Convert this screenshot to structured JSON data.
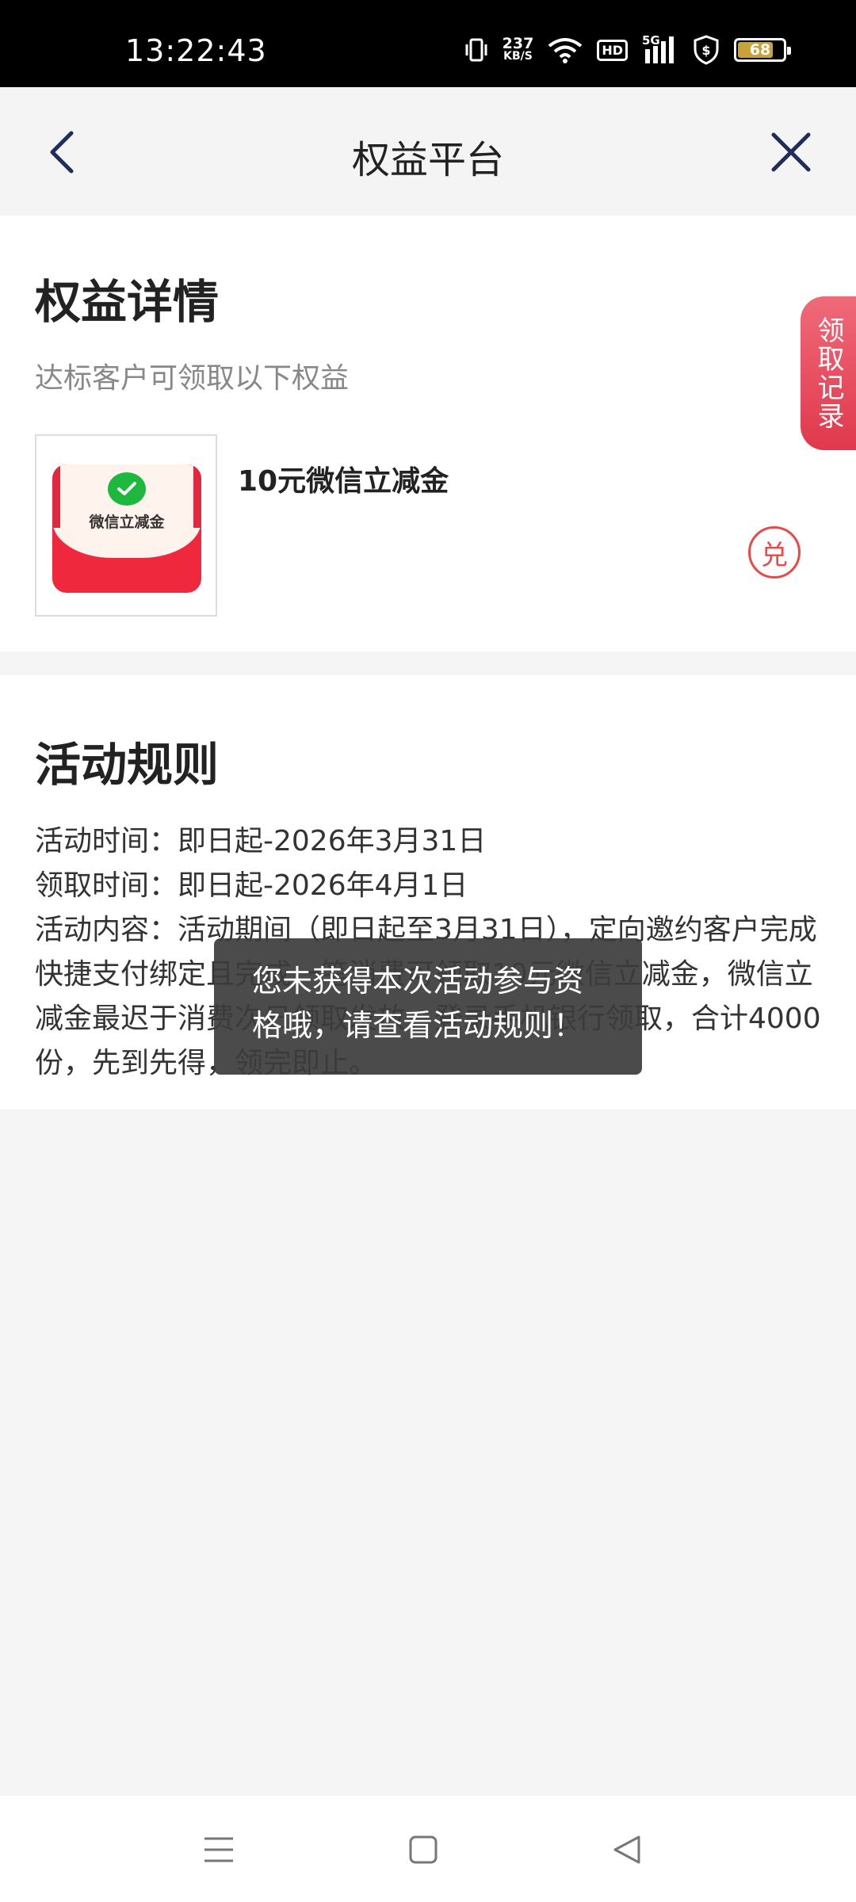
{
  "status_bar": {
    "time": "13:22:43",
    "net_speed_value": "237",
    "net_speed_unit": "KB/S",
    "hd_label": "HD",
    "network_label": "5G",
    "battery_level": "68"
  },
  "nav": {
    "title": "权益平台"
  },
  "benefits": {
    "title": "权益详情",
    "subtitle": "达标客户可领取以下权益",
    "item": {
      "thumbnail_label": "微信立减金",
      "name": "10元微信立减金",
      "redeem_label": "兑"
    },
    "records_tab": "领取记录"
  },
  "rules": {
    "title": "活动规则",
    "activity_time": "活动时间：即日起-2026年3月31日",
    "claim_time": "领取时间：即日起-2026年4月1日",
    "content": "活动内容：活动期间（即日起至3月31日），定向邀约客户完成快捷支付绑定且完成一笔消费可领取10元微信立减金，微信立减金最迟于消费次日领取发放，登录手机银行领取，合计4000份，先到先得，领完即止。"
  },
  "toast": {
    "message": "您未获得本次活动参与资格哦，请查看活动规则！"
  },
  "colors": {
    "accent_red": "#e84a4a",
    "wechat_green": "#1fb83e"
  }
}
